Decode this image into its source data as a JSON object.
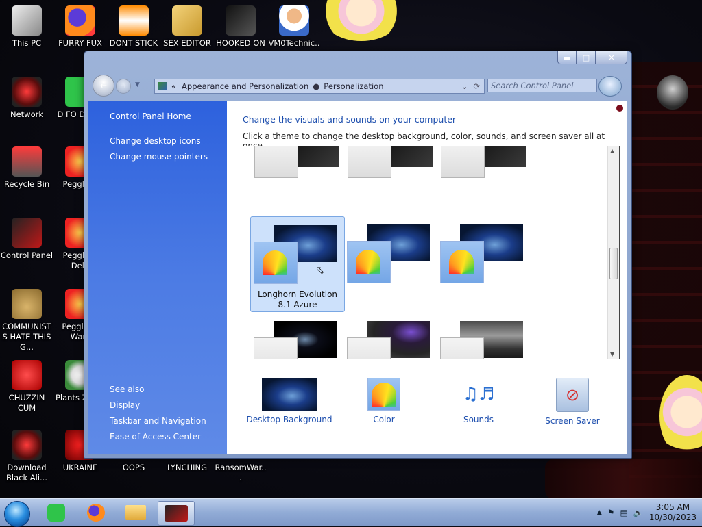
{
  "desktop": {
    "icons": [
      {
        "label": "This PC",
        "icon": "computer-icon"
      },
      {
        "label": "FURRY FUX",
        "icon": "firefox-icon"
      },
      {
        "label": "DONT STICK",
        "icon": "vlc-cone-icon"
      },
      {
        "label": "SEX EDITOR",
        "icon": "hxd-hex-editor-icon"
      },
      {
        "label": "HOOKED ON",
        "icon": "maze-game-icon"
      },
      {
        "label": "VM0Technic...",
        "icon": "doctor-avatar-icon"
      },
      {
        "label": "Network",
        "icon": "network-orb-icon"
      },
      {
        "label": "D FO DUMB",
        "icon": "green-app-icon"
      },
      {
        "label": "Recycle Bin",
        "icon": "recycle-bin-icon"
      },
      {
        "label": "Peggle D",
        "icon": "peggle-icon"
      },
      {
        "label": "Control Panel",
        "icon": "control-panel-icon"
      },
      {
        "label": "Peggle N Delu",
        "icon": "peggle-icon"
      },
      {
        "label": "COMMUNISTS HATE THIS G...",
        "icon": "money-bag-icon"
      },
      {
        "label": "Peggle of Warc",
        "icon": "peggle-icon"
      },
      {
        "label": "CHUZZIN CUM",
        "icon": "chuzzle-icon"
      },
      {
        "label": "Plants Zomb",
        "icon": "plant-icon"
      },
      {
        "label": "Download Black Ali...",
        "icon": "alien-orb-icon"
      },
      {
        "label": "UKRAINE",
        "icon": "radiation-icon"
      },
      {
        "label": "OOPS",
        "icon": "blank-icon"
      },
      {
        "label": "LYNCHING",
        "icon": "blank-icon"
      },
      {
        "label": "RansomWar...",
        "icon": "blank-icon"
      }
    ]
  },
  "window": {
    "address": {
      "overflow": "«",
      "crumb1": "Appearance and Personalization",
      "crumb2": "Personalization"
    },
    "search_placeholder": "Search Control Panel",
    "sidebar": {
      "home": "Control Panel Home",
      "links": [
        "Change desktop icons",
        "Change mouse pointers"
      ],
      "see_also_title": "See also",
      "see_also": [
        "Display",
        "Taskbar and Navigation",
        "Ease of Access Center"
      ]
    },
    "main": {
      "title": "Change the visuals and sounds on your computer",
      "subtitle": "Click a theme to change the desktop background, color, sounds, and screen saver all at once.",
      "selected_theme": {
        "line1": "Longhorn Evolution",
        "line2": "8.1 Azure"
      },
      "bottom_items": [
        {
          "label": "Desktop Background",
          "icon": "wallpaper-thumb-icon"
        },
        {
          "label": "Color",
          "icon": "color-fan-icon"
        },
        {
          "label": "Sounds",
          "icon": "music-keyboard-icon"
        },
        {
          "label": "Screen Saver",
          "icon": "screen-saver-icon"
        }
      ]
    }
  },
  "taskbar": {
    "pinned": [
      "start-orb-icon",
      "green-app-icon",
      "firefox-icon",
      "file-explorer-icon",
      "control-panel-icon"
    ],
    "time": "3:05 AM",
    "date": "10/30/2023"
  }
}
